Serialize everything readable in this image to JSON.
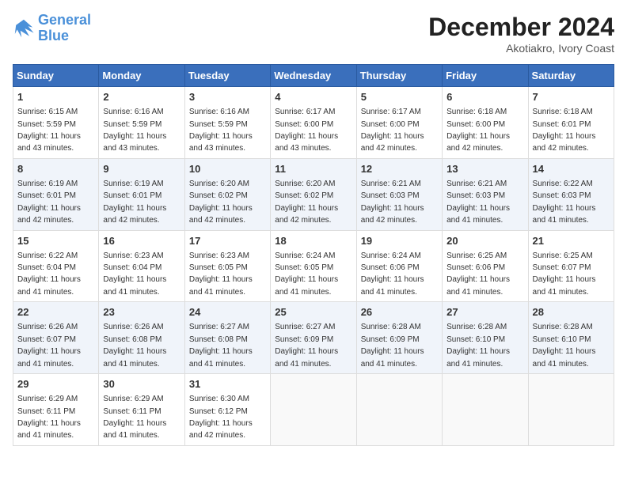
{
  "header": {
    "logo_line1": "General",
    "logo_line2": "Blue",
    "month_title": "December 2024",
    "location": "Akotiakro, Ivory Coast"
  },
  "weekdays": [
    "Sunday",
    "Monday",
    "Tuesday",
    "Wednesday",
    "Thursday",
    "Friday",
    "Saturday"
  ],
  "weeks": [
    [
      {
        "day": "1",
        "sunrise": "6:15 AM",
        "sunset": "5:59 PM",
        "daylight": "11 hours and 43 minutes."
      },
      {
        "day": "2",
        "sunrise": "6:16 AM",
        "sunset": "5:59 PM",
        "daylight": "11 hours and 43 minutes."
      },
      {
        "day": "3",
        "sunrise": "6:16 AM",
        "sunset": "5:59 PM",
        "daylight": "11 hours and 43 minutes."
      },
      {
        "day": "4",
        "sunrise": "6:17 AM",
        "sunset": "6:00 PM",
        "daylight": "11 hours and 43 minutes."
      },
      {
        "day": "5",
        "sunrise": "6:17 AM",
        "sunset": "6:00 PM",
        "daylight": "11 hours and 42 minutes."
      },
      {
        "day": "6",
        "sunrise": "6:18 AM",
        "sunset": "6:00 PM",
        "daylight": "11 hours and 42 minutes."
      },
      {
        "day": "7",
        "sunrise": "6:18 AM",
        "sunset": "6:01 PM",
        "daylight": "11 hours and 42 minutes."
      }
    ],
    [
      {
        "day": "8",
        "sunrise": "6:19 AM",
        "sunset": "6:01 PM",
        "daylight": "11 hours and 42 minutes."
      },
      {
        "day": "9",
        "sunrise": "6:19 AM",
        "sunset": "6:01 PM",
        "daylight": "11 hours and 42 minutes."
      },
      {
        "day": "10",
        "sunrise": "6:20 AM",
        "sunset": "6:02 PM",
        "daylight": "11 hours and 42 minutes."
      },
      {
        "day": "11",
        "sunrise": "6:20 AM",
        "sunset": "6:02 PM",
        "daylight": "11 hours and 42 minutes."
      },
      {
        "day": "12",
        "sunrise": "6:21 AM",
        "sunset": "6:03 PM",
        "daylight": "11 hours and 42 minutes."
      },
      {
        "day": "13",
        "sunrise": "6:21 AM",
        "sunset": "6:03 PM",
        "daylight": "11 hours and 41 minutes."
      },
      {
        "day": "14",
        "sunrise": "6:22 AM",
        "sunset": "6:03 PM",
        "daylight": "11 hours and 41 minutes."
      }
    ],
    [
      {
        "day": "15",
        "sunrise": "6:22 AM",
        "sunset": "6:04 PM",
        "daylight": "11 hours and 41 minutes."
      },
      {
        "day": "16",
        "sunrise": "6:23 AM",
        "sunset": "6:04 PM",
        "daylight": "11 hours and 41 minutes."
      },
      {
        "day": "17",
        "sunrise": "6:23 AM",
        "sunset": "6:05 PM",
        "daylight": "11 hours and 41 minutes."
      },
      {
        "day": "18",
        "sunrise": "6:24 AM",
        "sunset": "6:05 PM",
        "daylight": "11 hours and 41 minutes."
      },
      {
        "day": "19",
        "sunrise": "6:24 AM",
        "sunset": "6:06 PM",
        "daylight": "11 hours and 41 minutes."
      },
      {
        "day": "20",
        "sunrise": "6:25 AM",
        "sunset": "6:06 PM",
        "daylight": "11 hours and 41 minutes."
      },
      {
        "day": "21",
        "sunrise": "6:25 AM",
        "sunset": "6:07 PM",
        "daylight": "11 hours and 41 minutes."
      }
    ],
    [
      {
        "day": "22",
        "sunrise": "6:26 AM",
        "sunset": "6:07 PM",
        "daylight": "11 hours and 41 minutes."
      },
      {
        "day": "23",
        "sunrise": "6:26 AM",
        "sunset": "6:08 PM",
        "daylight": "11 hours and 41 minutes."
      },
      {
        "day": "24",
        "sunrise": "6:27 AM",
        "sunset": "6:08 PM",
        "daylight": "11 hours and 41 minutes."
      },
      {
        "day": "25",
        "sunrise": "6:27 AM",
        "sunset": "6:09 PM",
        "daylight": "11 hours and 41 minutes."
      },
      {
        "day": "26",
        "sunrise": "6:28 AM",
        "sunset": "6:09 PM",
        "daylight": "11 hours and 41 minutes."
      },
      {
        "day": "27",
        "sunrise": "6:28 AM",
        "sunset": "6:10 PM",
        "daylight": "11 hours and 41 minutes."
      },
      {
        "day": "28",
        "sunrise": "6:28 AM",
        "sunset": "6:10 PM",
        "daylight": "11 hours and 41 minutes."
      }
    ],
    [
      {
        "day": "29",
        "sunrise": "6:29 AM",
        "sunset": "6:11 PM",
        "daylight": "11 hours and 41 minutes."
      },
      {
        "day": "30",
        "sunrise": "6:29 AM",
        "sunset": "6:11 PM",
        "daylight": "11 hours and 41 minutes."
      },
      {
        "day": "31",
        "sunrise": "6:30 AM",
        "sunset": "6:12 PM",
        "daylight": "11 hours and 42 minutes."
      },
      null,
      null,
      null,
      null
    ]
  ]
}
